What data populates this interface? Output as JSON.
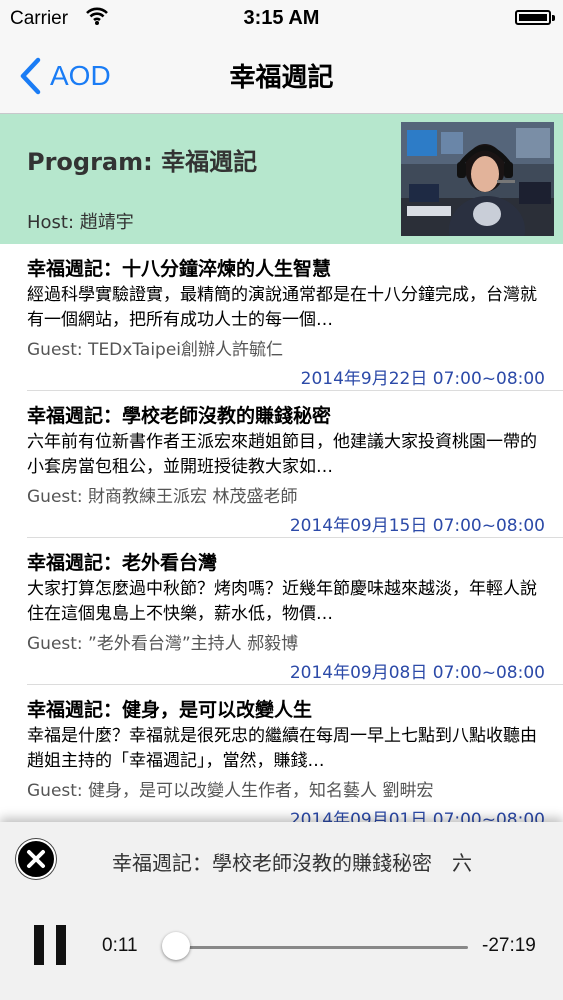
{
  "status_bar": {
    "carrier": "Carrier",
    "time": "3:15 AM"
  },
  "nav": {
    "back_label": "AOD",
    "title": "幸福週記"
  },
  "program": {
    "title": "Program: 幸福週記",
    "host": "Host: 趙靖宇"
  },
  "episodes": [
    {
      "title": "幸福週記：十八分鐘淬煉的人生智慧",
      "desc": "經過科學實驗證實，最精簡的演說通常都是在十八分鐘完成，台灣就有一個網站，把所有成功人士的每一個…",
      "guest": "Guest: TEDxTaipei創辦人許毓仁",
      "date": "2014年9月22日 07:00~08:00"
    },
    {
      "title": "幸福週記：學校老師沒教的賺錢秘密",
      "desc": "六年前有位新書作者王派宏來趙姐節目，他建議大家投資桃園一帶的小套房當包租公，並開班授徒教大家如…",
      "guest": "Guest: 財商教練王派宏 林茂盛老師",
      "date": "2014年09月15日 07:00~08:00"
    },
    {
      "title": "幸福週記：老外看台灣",
      "desc": "大家打算怎麼過中秋節？烤肉嗎？近幾年節慶味越來越淡，年輕人說住在這個鬼島上不快樂，薪水低，物價…",
      "guest": "Guest: ”老外看台灣”主持人 郝毅博",
      "date": "2014年09月08日 07:00~08:00"
    },
    {
      "title": "幸福週記：健身，是可以改變人生",
      "desc": "幸福是什麼？幸福就是很死忠的繼續在每周一早上七點到八點收聽由趙姐主持的「幸福週記」，當然，賺錢…",
      "guest": "Guest: 健身，是可以改變人生作者，知名藝人 劉畊宏",
      "date": "2014年09月01日 07:00~08:00"
    }
  ],
  "player": {
    "now_playing": "幸福週記：學校老師沒教的賺錢秘密　六",
    "elapsed": "0:11",
    "remaining": "-27:19",
    "progress": 0.007
  },
  "colors": {
    "accent": "#1a7cf5",
    "program_bg": "#b6e7cd",
    "date": "#2c4aa8"
  },
  "icons": [
    "wifi-icon",
    "battery-icon",
    "back-chevron-icon",
    "close-icon",
    "pause-icon"
  ]
}
